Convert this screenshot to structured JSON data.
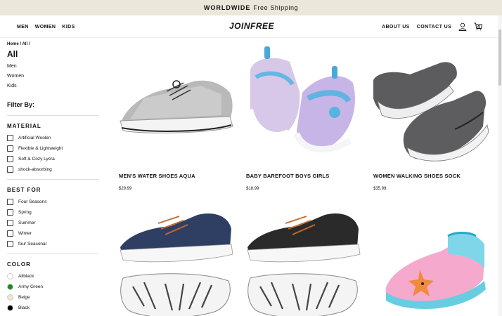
{
  "announcement": {
    "strong": "WORLDWIDE",
    "text": "Free Shipping"
  },
  "header": {
    "nav_left": [
      "MEN",
      "WOMEN",
      "KIDS"
    ],
    "logo": "JOINFREE",
    "nav_right": [
      "ABOUT US",
      "CONTACT US"
    ],
    "cart_count": "0",
    "icons": [
      "user-icon",
      "cart-icon"
    ]
  },
  "sidebar": {
    "breadcrumb": "Home / All /",
    "category_title": "All",
    "category_links": [
      "Men",
      "Women",
      "Kids"
    ],
    "filter_by": "Filter By:",
    "material": {
      "title": "MATERIAL",
      "options": [
        "Artificial Woolen",
        "Flexible & Lightweight",
        "Soft & Cozy Lycra",
        "shock-absorbing"
      ]
    },
    "best_for": {
      "title": "BEST FOR",
      "options": [
        "Four Seasons",
        "Spring",
        "Summer",
        "Winter",
        "four Seasonal"
      ]
    },
    "color": {
      "title": "COLOR",
      "options": [
        {
          "label": "Allblack",
          "swatch": "#ffffff"
        },
        {
          "label": "Army Green",
          "swatch": "#1a8a1a"
        },
        {
          "label": "Beige",
          "swatch": "#efe6cf"
        },
        {
          "label": "Black",
          "swatch": "#000000"
        }
      ]
    }
  },
  "products": [
    {
      "name": "MEN'S WATER SHOES AQUA",
      "price": "$29.99"
    },
    {
      "name": "BABY BAREFOOT BOYS GIRLS",
      "price": "$18.99"
    },
    {
      "name": "WOMEN WALKING SHOES SOCK",
      "price": "$35.99"
    },
    {
      "name": "",
      "price": ""
    },
    {
      "name": "",
      "price": ""
    },
    {
      "name": "",
      "price": ""
    }
  ]
}
